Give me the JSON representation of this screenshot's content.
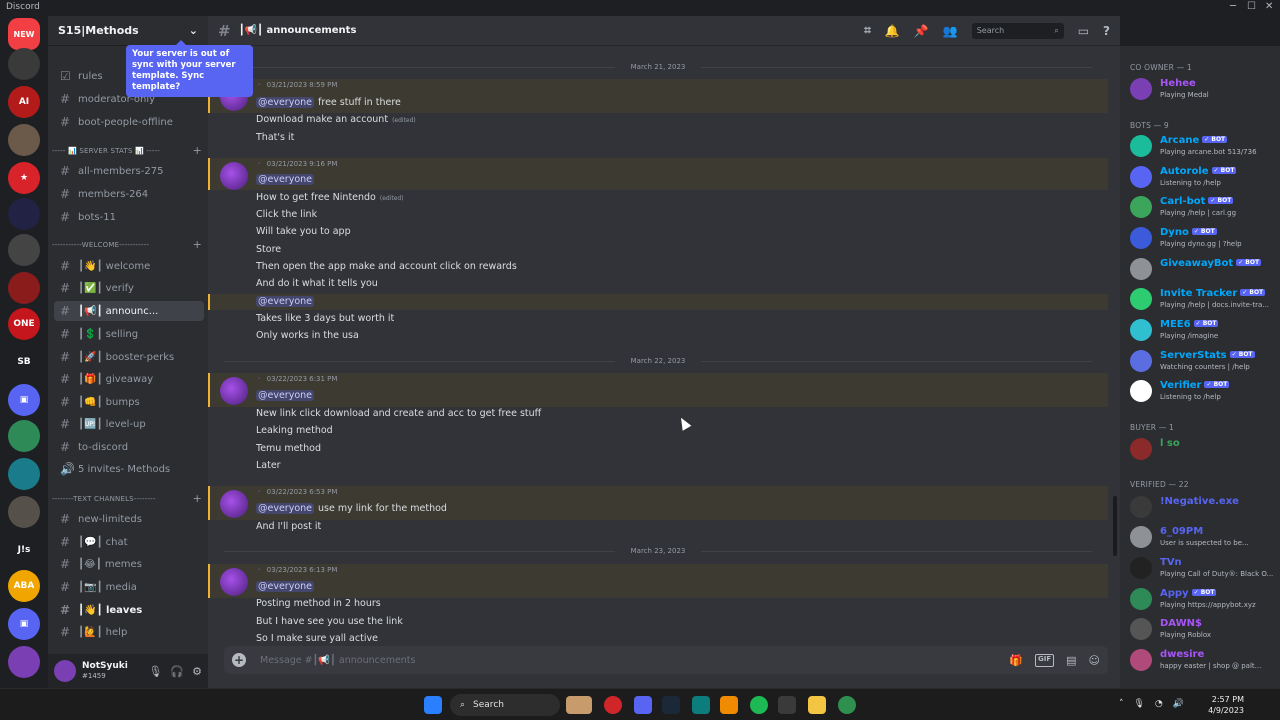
{
  "window": {
    "app_title": "Discord",
    "controls": [
      "─",
      "☐",
      "✕"
    ]
  },
  "rail": {
    "new_label": "NEW",
    "servers": [
      {
        "label": "",
        "color": "#3a3a3a",
        "badge": "6"
      },
      {
        "label": "AI",
        "color": "#b31b1b",
        "badge": "8"
      },
      {
        "label": "",
        "color": "#6b5a4a",
        "badge": "63"
      },
      {
        "label": "★",
        "color": "#d8232a",
        "badge": ""
      },
      {
        "label": "",
        "color": "#222244",
        "badge": ""
      },
      {
        "label": "",
        "color": "#444",
        "badge": "5"
      },
      {
        "label": "",
        "color": "#8a1c1c",
        "badge": ""
      },
      {
        "label": "ONE",
        "color": "#c4161c",
        "badge": "5"
      },
      {
        "label": "SB",
        "color": "#1e1f22",
        "badge": "70"
      },
      {
        "label": "▣",
        "color": "#5865f2",
        "badge": ""
      },
      {
        "label": "",
        "color": "#2e8b57",
        "badge": ""
      },
      {
        "label": "",
        "color": "#1a7b8a",
        "badge": "1"
      },
      {
        "label": "",
        "color": "#55504a",
        "badge": ""
      },
      {
        "label": "J!s",
        "color": "#1e1f22",
        "badge": ""
      },
      {
        "label": "ABA",
        "color": "#f0a500",
        "badge": "9"
      },
      {
        "label": "▣",
        "color": "#5865f2",
        "badge": ""
      },
      {
        "label": "",
        "color": "#7a3fb3",
        "badge": "4"
      }
    ]
  },
  "sidebar": {
    "server_name": "S15|Methods",
    "tooltip": "Your server is out of sync with your server template. Sync template?",
    "channels_top": [
      {
        "label": "rules",
        "icon": "☑"
      },
      {
        "label": "moderator-only",
        "icon": "#"
      },
      {
        "label": "boot-people-offline",
        "icon": "#"
      }
    ],
    "cat_stats": "----- 📊 SERVER STATS 📊 -----",
    "channels_stats": [
      "all-members-275",
      "members-264",
      "bots-11"
    ],
    "cat_welcome": "-----------WELCOME-----------",
    "channels_welcome": [
      "┃👋┃ welcome",
      "┃✅┃ verify",
      "┃📢┃ announc...",
      "┃💲┃ selling",
      "┃🚀┃ booster-perks",
      "┃🎁┃ giveaway",
      "┃👊┃ bumps",
      "┃🆙┃ level-up",
      "to-discord",
      "5 invites- Methods"
    ],
    "cat_text": "--------TEXT CHANNELS--------",
    "channels_text": [
      "new-limiteds",
      "┃💬┃ chat",
      "┃😂┃ memes",
      "┃📷┃ media",
      "┃👋┃ leaves",
      "┃🙋┃ help"
    ]
  },
  "user": {
    "name": "NotSyuki",
    "tag": "#1459"
  },
  "topbar": {
    "channel": "┃📢┃ announcements",
    "search_placeholder": "Search"
  },
  "chat": {
    "dates": [
      "March 21, 2023",
      "March 22, 2023",
      "March 23, 2023"
    ],
    "messages": [
      {
        "time": "03/21/2023 8:59 PM",
        "lines": [
          "free stuff in there",
          "Download make an account",
          "That's it"
        ]
      },
      {
        "time": "03/21/2023 9:16 PM",
        "lines": [
          "How to get free Nintendo",
          "Click the link",
          "Will take you to app",
          "Store",
          "Then open the app make and account click on rewards",
          "And do it what it tells you",
          "Takes like 3 days but worth it",
          "Only works in the usa"
        ]
      },
      {
        "time": "03/22/2023 6:31 PM",
        "lines": [
          "New link click download and create and acc to get free stuff",
          "Leaking method",
          "Temu method",
          "Later"
        ]
      },
      {
        "time": "03/22/2023 6:53 PM",
        "lines": [
          "use my link for the method",
          "And I'll post it"
        ]
      },
      {
        "time": "03/23/2023 6:13 PM",
        "lines": [
          "Posting method in 2 hours",
          "But I have see you use the link",
          "So I make sure yall active"
        ]
      }
    ],
    "mention": "@everyone",
    "edited": "(edited)",
    "composer_placeholder": "Message #┃📢┃ announcements"
  },
  "members": {
    "groups": [
      "CO OWNER — 1",
      "BOTS — 9",
      "BUYER — 1",
      "VERIFIED — 22"
    ],
    "co_owner": {
      "name": "Hehee",
      "activity": "Playing Medal"
    },
    "bots": [
      {
        "name": "Arcane",
        "activity": "Playing arcane.bot 513/736",
        "color": "#1abc9c"
      },
      {
        "name": "Autorole",
        "activity": "Listening to /help",
        "color": "#5865f2"
      },
      {
        "name": "Carl-bot",
        "activity": "Playing /help | carl.gg",
        "color": "#3ba55c"
      },
      {
        "name": "Dyno",
        "activity": "Playing dyno.gg | ?help",
        "color": "#3b5bdb"
      },
      {
        "name": "GiveawayBot",
        "activity": "",
        "color": "#8e9297"
      },
      {
        "name": "Invite Tracker",
        "activity": "Playing /help | docs.invite-tra...",
        "color": "#2ecc71"
      },
      {
        "name": "MEE6",
        "activity": "Playing /imagine",
        "color": "#2fbfd1"
      },
      {
        "name": "ServerStats",
        "activity": "Watching counters | /help",
        "color": "#5b6ee1"
      },
      {
        "name": "Verifier",
        "activity": "Listening to /help",
        "color": "#ffffff"
      }
    ],
    "buyer": {
      "name": "l so",
      "activity": ""
    },
    "verified": [
      {
        "name": "!Negative.exe",
        "activity": ""
      },
      {
        "name": "6_09PM",
        "activity": "User is suspected to be..."
      },
      {
        "name": "TVn",
        "activity": "Playing Call of Duty®: Black O..."
      },
      {
        "name": "Appy",
        "activity": "Playing https://appybot.xyz"
      },
      {
        "name": "DAWN$",
        "activity": "Playing Roblox"
      },
      {
        "name": "dwesire",
        "activity": "happy easter | shop @ palt..."
      }
    ],
    "bot_tag": "✓ BOT"
  },
  "taskbar": {
    "search_label": "Search",
    "time": "2:57 PM",
    "date": "4/9/2023"
  },
  "colors": {
    "accent": "#5865f2",
    "mention_highlight": "#f0b232",
    "bot_name": "#00a8fc"
  }
}
